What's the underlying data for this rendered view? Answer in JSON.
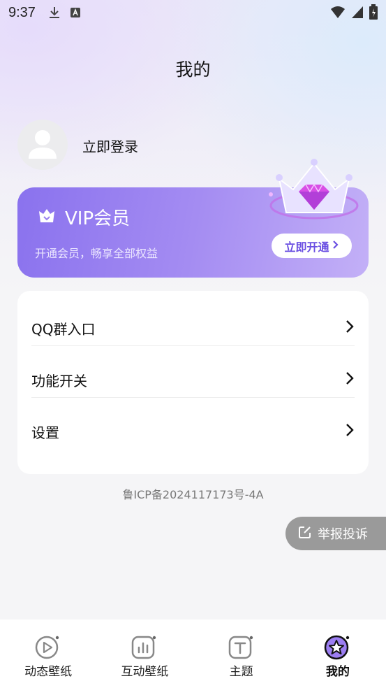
{
  "status_bar": {
    "time": "9:37"
  },
  "header": {
    "title": "我的"
  },
  "profile": {
    "login_label": "立即登录"
  },
  "vip": {
    "title": "VIP会员",
    "subtitle": "开通会员，畅享全部权益",
    "button_label": "立即开通",
    "accent": "#8a72ee"
  },
  "menu": {
    "items": [
      {
        "label": "QQ群入口"
      },
      {
        "label": "功能开关"
      },
      {
        "label": "设置"
      }
    ]
  },
  "footer": {
    "icp": "鲁ICP备2024117173号-4A"
  },
  "report": {
    "label": "举报投诉"
  },
  "tabs": [
    {
      "label": "动态壁纸",
      "icon": "play-icon"
    },
    {
      "label": "互动壁纸",
      "icon": "chart-icon"
    },
    {
      "label": "主题",
      "icon": "text-icon"
    },
    {
      "label": "我的",
      "icon": "star-icon"
    }
  ],
  "active_tab": "我的"
}
